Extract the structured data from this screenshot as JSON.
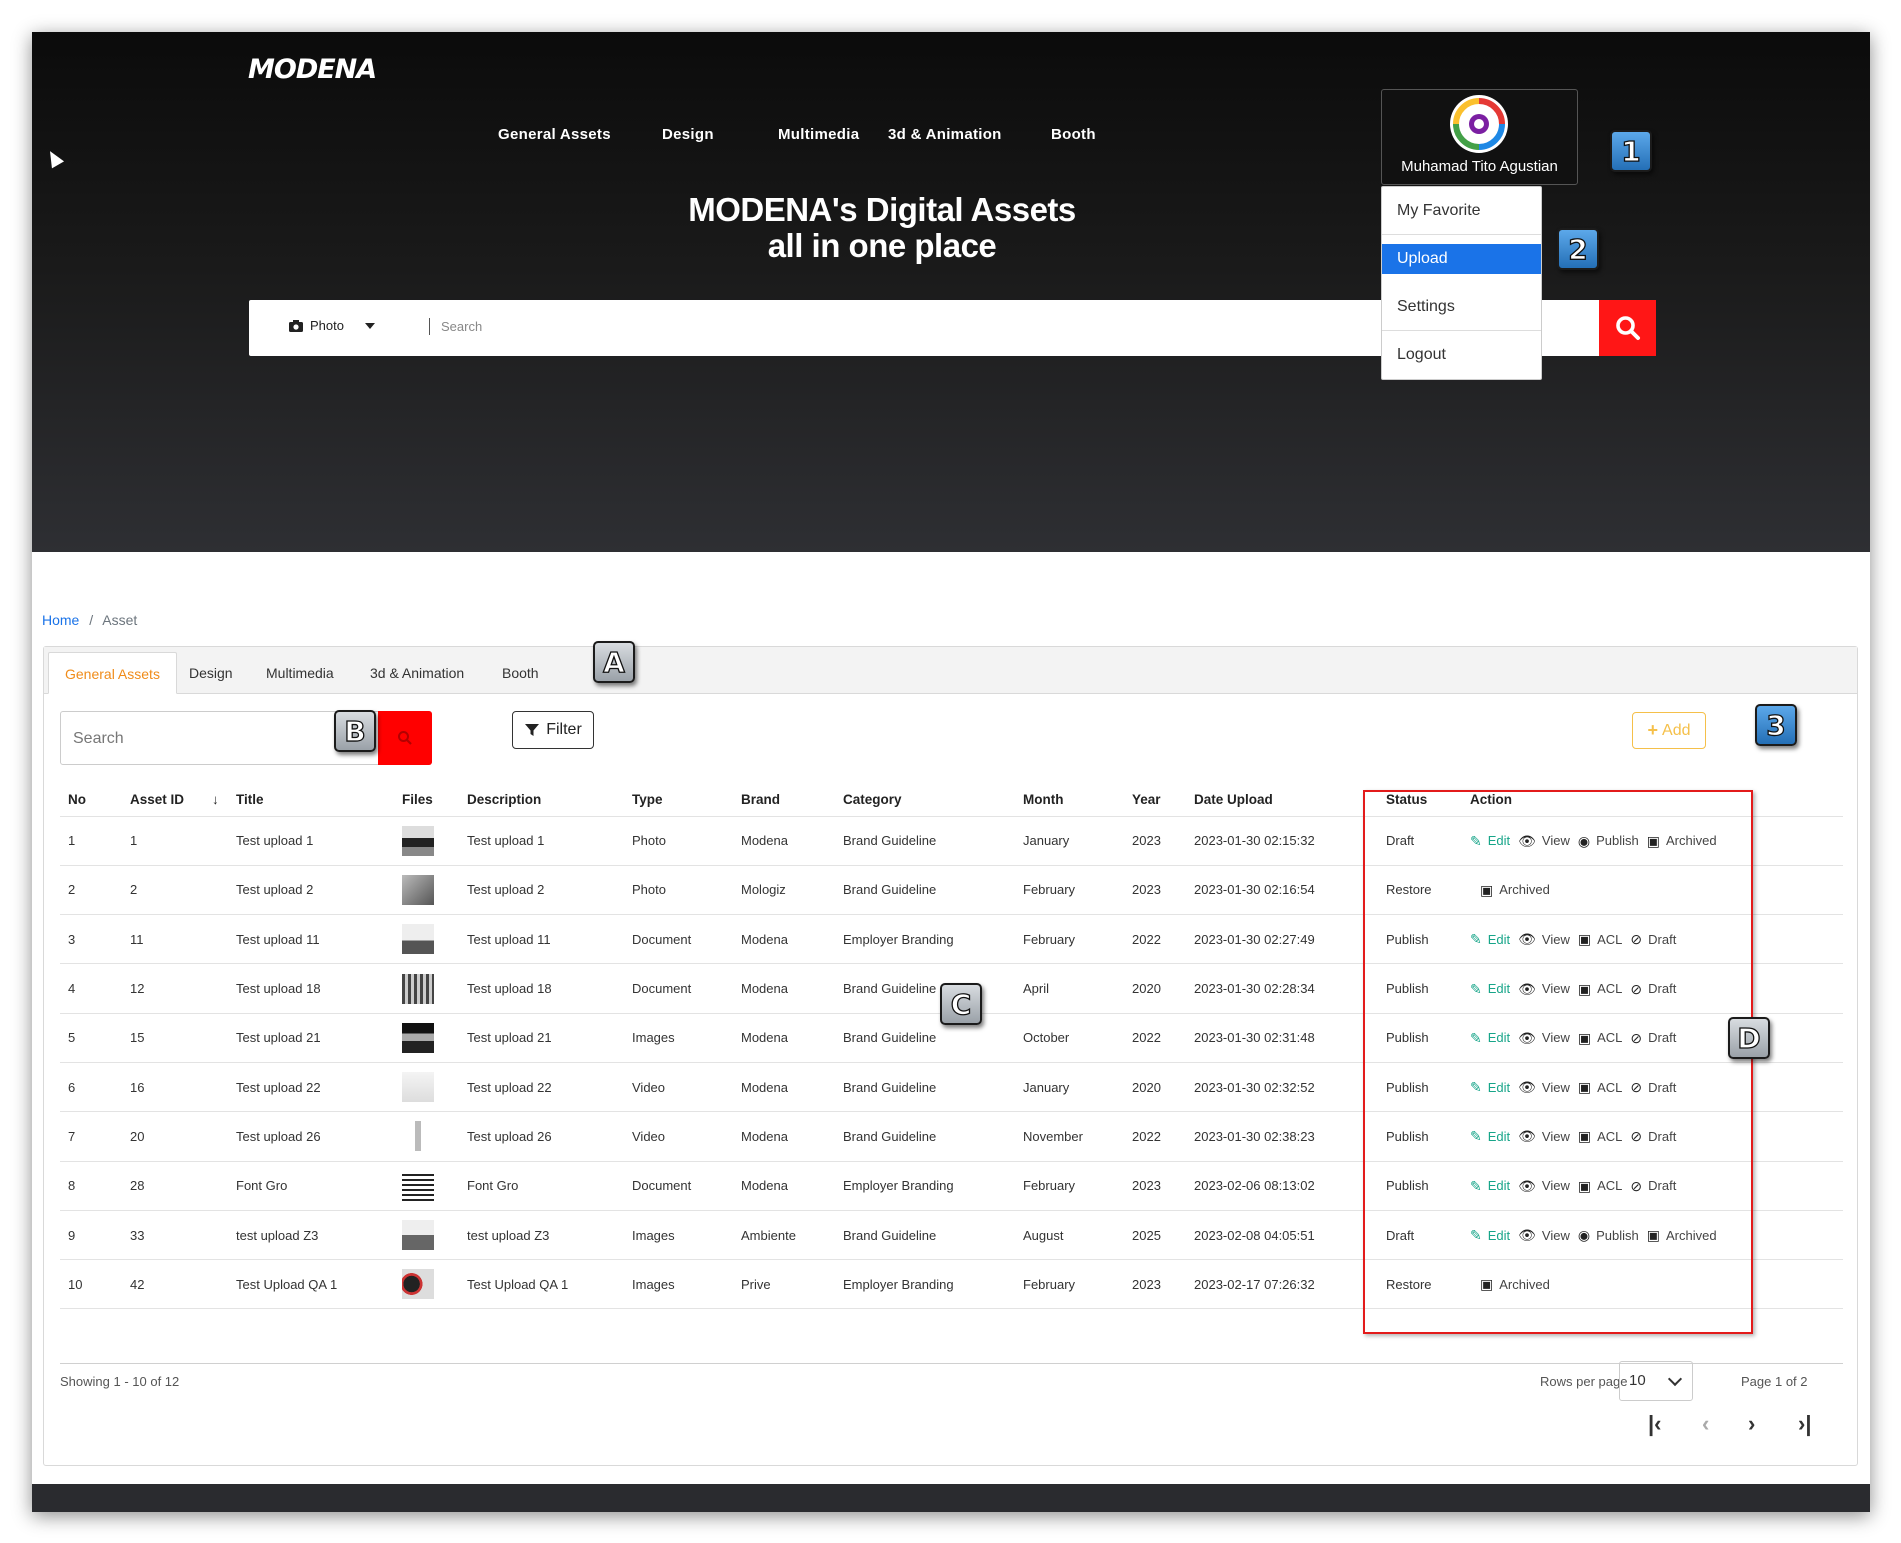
{
  "brand": {
    "logo_text": "MODENA"
  },
  "topnav": [
    "General Assets",
    "Design",
    "Multimedia",
    "3d & Animation",
    "Booth"
  ],
  "hero": {
    "line1": "MODENA's Digital Assets",
    "line2": "all in one place"
  },
  "hero_search": {
    "type_label": "Photo",
    "placeholder": "Search"
  },
  "user": {
    "name": "Muhamad Tito Agustian"
  },
  "user_menu": [
    "My Favorite",
    "Upload",
    "Settings",
    "Logout"
  ],
  "annotations": [
    "1",
    "2",
    "3",
    "A",
    "B",
    "C",
    "D"
  ],
  "breadcrumb": {
    "home": "Home",
    "separator": "/",
    "current": "Asset"
  },
  "tabs": [
    "General Assets",
    "Design",
    "Multimedia",
    "3d & Animation",
    "Booth"
  ],
  "toolbar": {
    "search_placeholder": "Search",
    "filter_label": "Filter",
    "add_label": "Add"
  },
  "table": {
    "headers": [
      "No",
      "Asset ID",
      "Title",
      "Files",
      "Description",
      "Type",
      "Brand",
      "Category",
      "Month",
      "Year",
      "Date Upload",
      "Status",
      "Action"
    ],
    "rows": [
      {
        "no": "1",
        "id": "1",
        "title": "Test upload 1",
        "desc": "Test upload 1",
        "type": "Photo",
        "brand": "Modena",
        "category": "Brand Guideline",
        "month": "January",
        "year": "2023",
        "date": "2023-01-30 02:15:32",
        "status": "Draft",
        "actions": [
          "Edit",
          "View",
          "Publish",
          "Archived"
        ]
      },
      {
        "no": "2",
        "id": "2",
        "title": "Test upload 2",
        "desc": "Test upload 2",
        "type": "Photo",
        "brand": "Mologiz",
        "category": "Brand Guideline",
        "month": "February",
        "year": "2023",
        "date": "2023-01-30 02:16:54",
        "status": "Restore",
        "actions": [
          "Archived"
        ]
      },
      {
        "no": "3",
        "id": "11",
        "title": "Test upload 11",
        "desc": "Test upload 11",
        "type": "Document",
        "brand": "Modena",
        "category": "Employer Branding",
        "month": "February",
        "year": "2022",
        "date": "2023-01-30 02:27:49",
        "status": "Publish",
        "actions": [
          "Edit",
          "View",
          "ACL",
          "Draft"
        ]
      },
      {
        "no": "4",
        "id": "12",
        "title": "Test upload 18",
        "desc": "Test upload 18",
        "type": "Document",
        "brand": "Modena",
        "category": "Brand Guideline",
        "month": "April",
        "year": "2020",
        "date": "2023-01-30 02:28:34",
        "status": "Publish",
        "actions": [
          "Edit",
          "View",
          "ACL",
          "Draft"
        ]
      },
      {
        "no": "5",
        "id": "15",
        "title": "Test upload 21",
        "desc": "Test upload 21",
        "type": "Images",
        "brand": "Modena",
        "category": "Brand Guideline",
        "month": "October",
        "year": "2022",
        "date": "2023-01-30 02:31:48",
        "status": "Publish",
        "actions": [
          "Edit",
          "View",
          "ACL",
          "Draft"
        ]
      },
      {
        "no": "6",
        "id": "16",
        "title": "Test upload 22",
        "desc": "Test upload 22",
        "type": "Video",
        "brand": "Modena",
        "category": "Brand Guideline",
        "month": "January",
        "year": "2020",
        "date": "2023-01-30 02:32:52",
        "status": "Publish",
        "actions": [
          "Edit",
          "View",
          "ACL",
          "Draft"
        ]
      },
      {
        "no": "7",
        "id": "20",
        "title": "Test upload 26",
        "desc": "Test upload 26",
        "type": "Video",
        "brand": "Modena",
        "category": "Brand Guideline",
        "month": "November",
        "year": "2022",
        "date": "2023-01-30 02:38:23",
        "status": "Publish",
        "actions": [
          "Edit",
          "View",
          "ACL",
          "Draft"
        ]
      },
      {
        "no": "8",
        "id": "28",
        "title": "Font Gro",
        "desc": "Font Gro",
        "type": "Document",
        "brand": "Modena",
        "category": "Employer Branding",
        "month": "February",
        "year": "2023",
        "date": "2023-02-06 08:13:02",
        "status": "Publish",
        "actions": [
          "Edit",
          "View",
          "ACL",
          "Draft"
        ]
      },
      {
        "no": "9",
        "id": "33",
        "title": "test upload Z3",
        "desc": "test upload Z3",
        "type": "Images",
        "brand": "Ambiente",
        "category": "Brand Guideline",
        "month": "August",
        "year": "2025",
        "date": "2023-02-08 04:05:51",
        "status": "Draft",
        "actions": [
          "Edit",
          "View",
          "Publish",
          "Archived"
        ]
      },
      {
        "no": "10",
        "id": "42",
        "title": "Test Upload QA 1",
        "desc": "Test Upload QA 1",
        "type": "Images",
        "brand": "Prive",
        "category": "Employer Branding",
        "month": "February",
        "year": "2023",
        "date": "2023-02-17 07:26:32",
        "status": "Restore",
        "actions": [
          "Archived"
        ]
      }
    ]
  },
  "pagination": {
    "showing": "Showing 1 - 10 of 12",
    "rows_label": "Rows per page",
    "rows_value": "10",
    "page_label": "Page 1 of 2"
  },
  "colors": {
    "accent_orange": "#f08c1a",
    "primary_blue": "#1a73e8",
    "search_red": "#ff1616",
    "edit_green": "#17a589",
    "add_yellow": "#f5c04a"
  }
}
